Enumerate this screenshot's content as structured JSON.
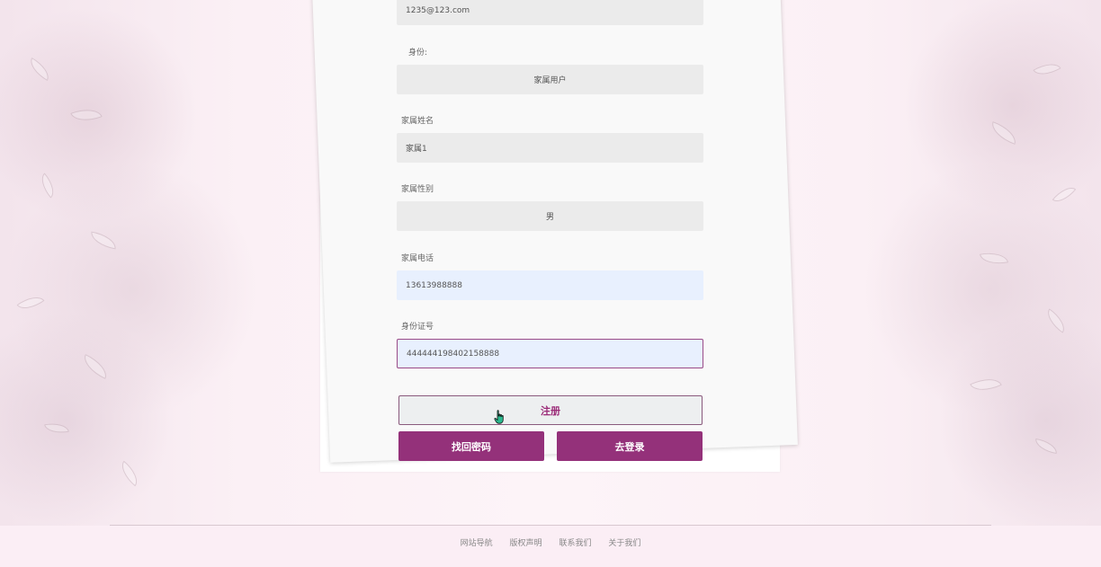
{
  "form": {
    "email": {
      "value": "1235@123.com"
    },
    "identity": {
      "label": "身份:",
      "value": "家属用户"
    },
    "family_name": {
      "label": "家属姓名",
      "value": "家属1"
    },
    "family_gender": {
      "label": "家属性别",
      "value": "男"
    },
    "family_phone": {
      "label": "家属电话",
      "value": "13613988888"
    },
    "id_number": {
      "label": "身份证号",
      "value": "444444198402158888"
    }
  },
  "buttons": {
    "register": "注册",
    "find_password": "找回密码",
    "go_login": "去登录"
  },
  "footer": {
    "links": [
      "网站导航",
      "版权声明",
      "联系我们",
      "关于我们"
    ]
  },
  "colors": {
    "accent": "#94317a",
    "page_background": "#fbeef5"
  },
  "icons": {
    "cursor": "hand-pointer-icon"
  }
}
